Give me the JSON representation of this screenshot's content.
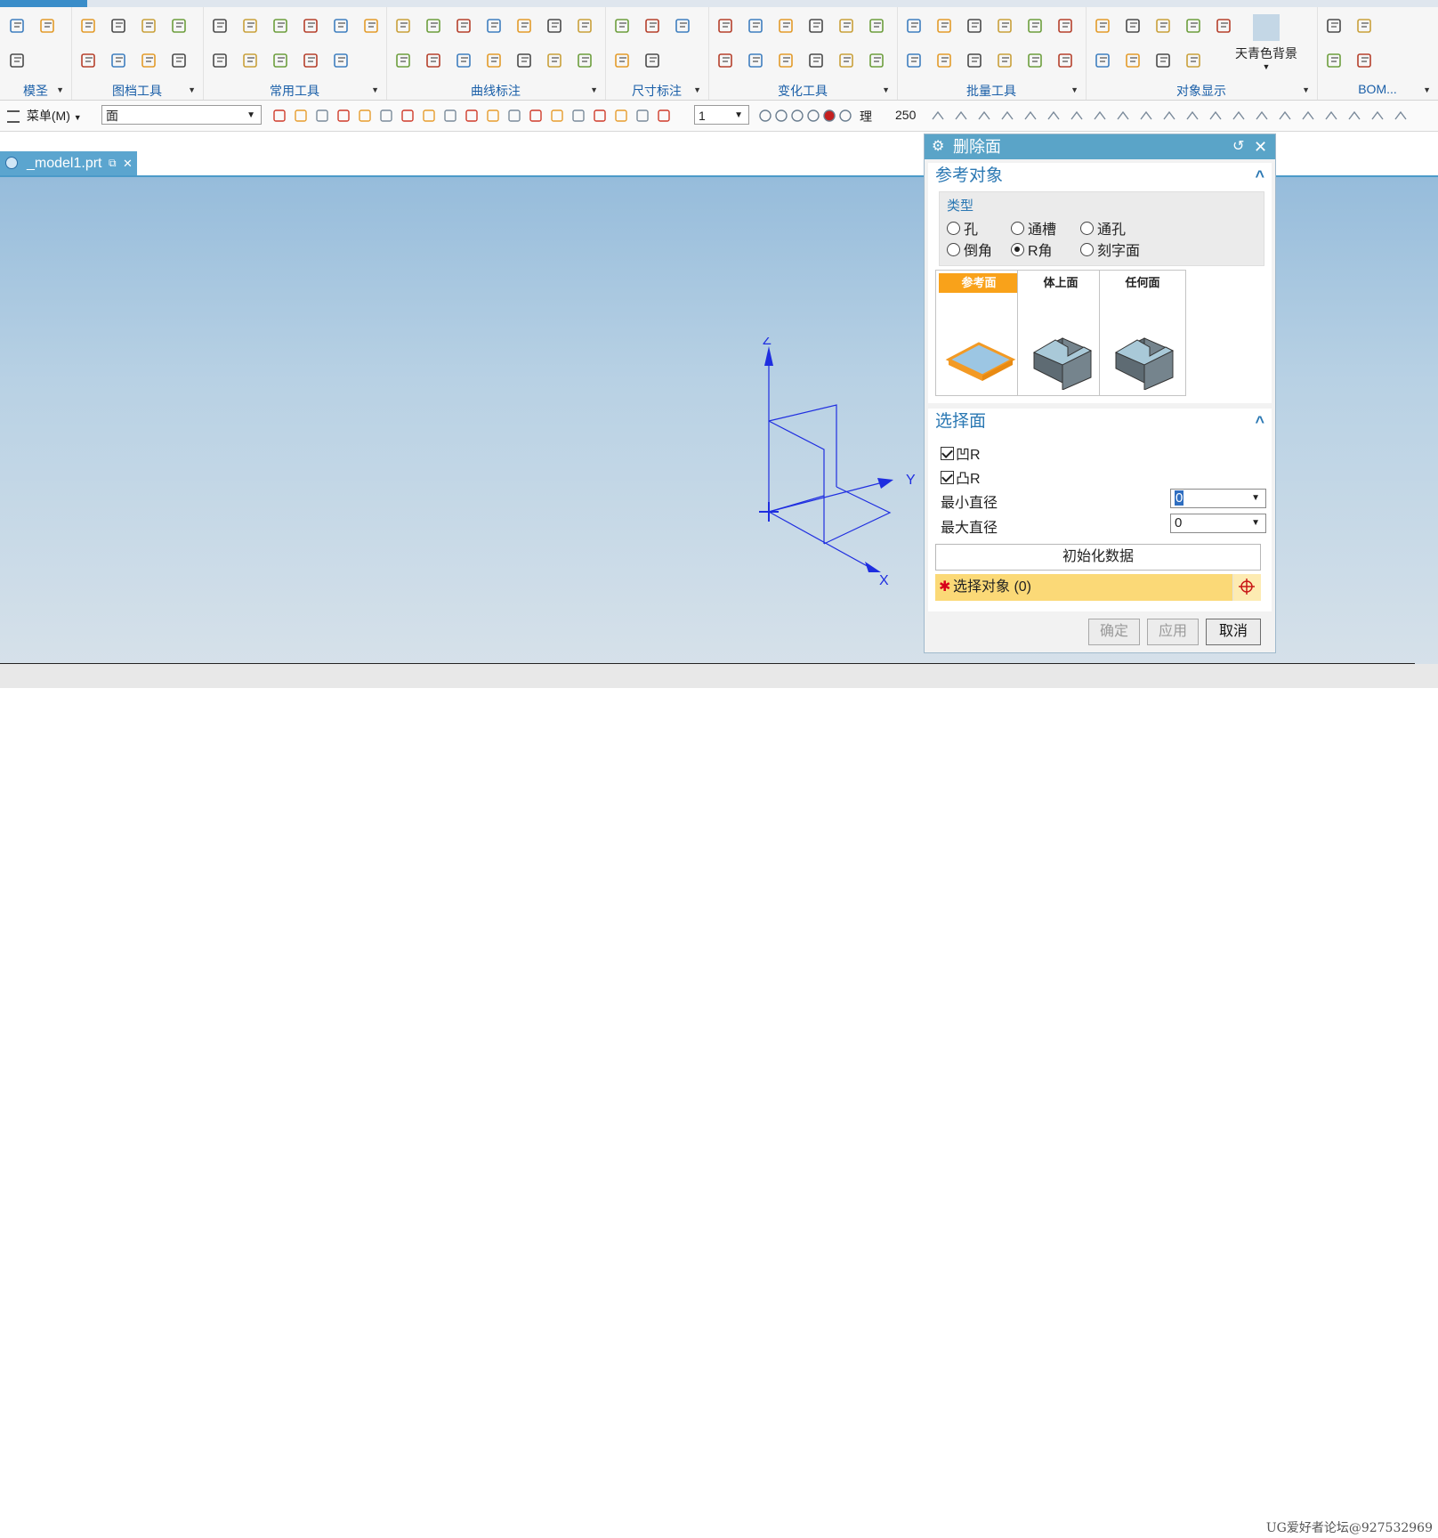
{
  "ribbon": {
    "groups": [
      {
        "label": "模圣",
        "icons": [
          "gear-icon",
          "settings-list-icon",
          "f-box-icon"
        ]
      },
      {
        "label": "图档工具",
        "icons": [
          "parts-icon",
          "open-folder-icon",
          "folder-icon",
          "document-icon",
          "save-icon",
          "new-doc-icon",
          "page-icon",
          "export-icon"
        ]
      },
      {
        "label": "常用工具",
        "icons": [
          "measure-icon",
          "weight-icon",
          "text-icon",
          "box-icon",
          "frame-icon",
          "calculator-icon",
          "draft-icon",
          "cylinder-group-icon",
          "red-cube-icon",
          "pipe-icon",
          "bolt-icon"
        ]
      },
      {
        "label": "曲线标注",
        "icons": [
          "crosshair-add-icon",
          "mirror-icon",
          "surface-icon",
          "parallel-lines-icon",
          "target-icon",
          "k-circle-icon",
          "angle-icon",
          "split-icon",
          "cube-icon",
          "plane-icon",
          "spline-icon",
          "curve-fx-icon",
          "point-circle-icon",
          "e-box-icon"
        ]
      },
      {
        "label": "尺寸标注",
        "icons": [
          "a-box-icon",
          "list-icon",
          "dim-icon",
          "a-text-icon",
          "cone-icon"
        ]
      },
      {
        "label": "变化工具",
        "icons": [
          "copy-icon",
          "move-icon",
          "transform-icon",
          "line-icon",
          "check-icon",
          "scatter-icon",
          "array-icon",
          "axis-icon",
          "grid-icon",
          "diagonal-icon",
          "pattern-icon",
          "dots-icon"
        ]
      },
      {
        "label": "批量工具",
        "icons": [
          "batch-box-icon",
          "cube-x-icon",
          "cube-color-icon",
          "layers-icon",
          "cross-icon",
          "table-x-icon",
          "batch-edit-icon",
          "cylinder-icon",
          "stack-icon",
          "table-icon",
          "bar-x-icon",
          "dimension-x-icon"
        ]
      },
      {
        "label": "对象显示",
        "icons": [
          "view-icon",
          "network-icon",
          "layer-show-icon",
          "stack-layers-icon",
          "orange-box-icon",
          "hide-icon",
          "color-ball-icon",
          "mesh-icon",
          "stack-show-icon"
        ],
        "extra_label": "天青色背景"
      },
      {
        "label": "BOM...",
        "icons": [
          "bom-icon",
          "tag-icon",
          "pen-icon",
          "bom-table-icon"
        ]
      }
    ]
  },
  "toolbar": {
    "menu_label": "菜单(M)",
    "filter_value": "面",
    "number_value": "1",
    "label_li": "理",
    "label_250": "250"
  },
  "document_tab": {
    "label": "_model1.prt"
  },
  "triad": {
    "z_label": "Z",
    "y_label": "Y",
    "x_label": "X"
  },
  "dialog": {
    "title": "删除面",
    "section_reference": {
      "title": "参考对象"
    },
    "type_group": {
      "label": "类型",
      "options": [
        {
          "label": "孔",
          "selected": false
        },
        {
          "label": "通槽",
          "selected": false
        },
        {
          "label": "通孔",
          "selected": false
        },
        {
          "label": "倒角",
          "selected": false
        },
        {
          "label": "R角",
          "selected": true
        },
        {
          "label": "刻字面",
          "selected": false
        }
      ]
    },
    "thumbnails": [
      {
        "label": "参考面",
        "active": true
      },
      {
        "label": "体上面",
        "active": false
      },
      {
        "label": "任何面",
        "active": false
      }
    ],
    "section_select": {
      "title": "选择面"
    },
    "checkboxes": [
      {
        "label": "凹R",
        "checked": true
      },
      {
        "label": "凸R",
        "checked": true
      }
    ],
    "min_diameter": {
      "label": "最小直径",
      "value": "0"
    },
    "max_diameter": {
      "label": "最大直径",
      "value": "0"
    },
    "init_button": "初始化数据",
    "select_object": "选择对象 (0)",
    "buttons": {
      "ok": "确定",
      "apply": "应用",
      "cancel": "取消"
    }
  },
  "watermark": "UG爱好者论坛@927532969",
  "colors": {
    "accent": "#5aa4c8",
    "select_highlight": "#fbd977",
    "thumb_active": "#f9a21a",
    "triad": "#1f2ee0"
  }
}
